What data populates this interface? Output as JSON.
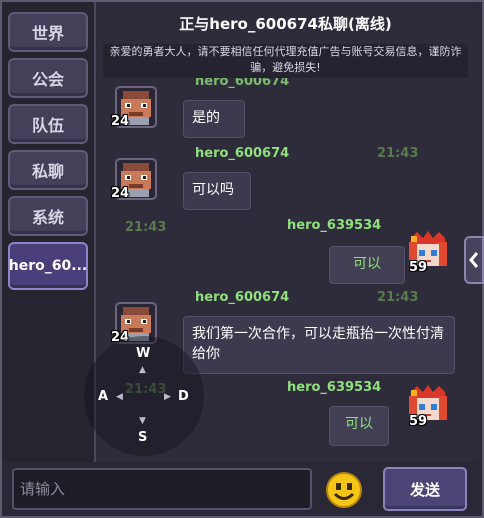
{
  "sidebar": {
    "tabs": [
      {
        "label": "世界"
      },
      {
        "label": "公会"
      },
      {
        "label": "队伍"
      },
      {
        "label": "私聊"
      },
      {
        "label": "系统"
      },
      {
        "label": "hero_60..."
      }
    ],
    "active_index": 5
  },
  "chat": {
    "title": "正与hero_600674私聊(离线)",
    "notice": "亲爱的勇者大人，请不要相信任何代理充值广告与账号交易信息，谨防诈骗，避免损失!",
    "partial_top_name": "hero_600674",
    "messages": [
      {
        "sender": "hero_600674",
        "level": "24",
        "text": "是的",
        "mine": false
      },
      {
        "sender": "hero_600674",
        "time": "21:43",
        "level": "24",
        "text": "可以吗",
        "mine": false
      },
      {
        "sender": "hero_639534",
        "time": "21:43",
        "level": "59",
        "text": "可以",
        "mine": true
      },
      {
        "sender": "hero_600674",
        "time": "21:43",
        "level": "24",
        "text": "我们第一次合作，可以走瓶抬一次性付清给你",
        "mine": false
      },
      {
        "sender": "hero_639534",
        "time": "21:43",
        "level": "59",
        "text": "可以",
        "mine": true
      }
    ]
  },
  "dpad": {
    "up": "W",
    "left": "A",
    "right": "D",
    "down": "S"
  },
  "input": {
    "placeholder": "请输入",
    "value": ""
  },
  "send_label": "发送",
  "icons": {
    "emoji": "smiley-icon",
    "expand": "chevron-left-icon"
  },
  "colors": {
    "name_green": "#8fe07c",
    "panel": "#2e2c3a",
    "accent": "#4b4474"
  }
}
